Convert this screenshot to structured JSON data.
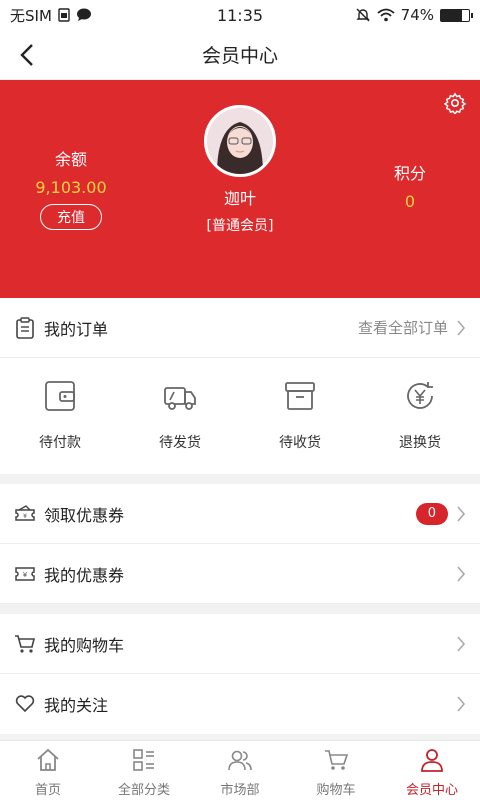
{
  "status": {
    "carrier": "无SIM",
    "time": "11:35",
    "battery": "74%",
    "battery_level": 0.74
  },
  "nav": {
    "title": "会员中心"
  },
  "profile": {
    "balance_label": "余额",
    "balance_value": "9,103.00",
    "recharge_label": "充值",
    "name": "迦叶",
    "level": "[普通会员]",
    "points_label": "积分",
    "points_value": "0"
  },
  "orders": {
    "title": "我的订单",
    "view_all": "查看全部订单",
    "items": [
      {
        "label": "待付款",
        "icon": "wallet-icon"
      },
      {
        "label": "待发货",
        "icon": "truck-icon"
      },
      {
        "label": "待收货",
        "icon": "box-icon"
      },
      {
        "label": "退换货",
        "icon": "refund-icon"
      }
    ]
  },
  "coupons": {
    "claim_label": "领取优惠券",
    "claim_count": "0",
    "mine_label": "我的优惠券"
  },
  "more": {
    "cart_label": "我的购物车",
    "follow_label": "我的关注"
  },
  "tabs": [
    {
      "label": "首页",
      "icon": "home-icon"
    },
    {
      "label": "全部分类",
      "icon": "category-icon"
    },
    {
      "label": "市场部",
      "icon": "people-icon"
    },
    {
      "label": "购物车",
      "icon": "cart-icon"
    },
    {
      "label": "会员中心",
      "icon": "person-icon"
    }
  ],
  "colors": {
    "brand_red": "#dc2a2d",
    "accent_yellow": "#ffd23f",
    "active_tab": "#c5222a"
  }
}
